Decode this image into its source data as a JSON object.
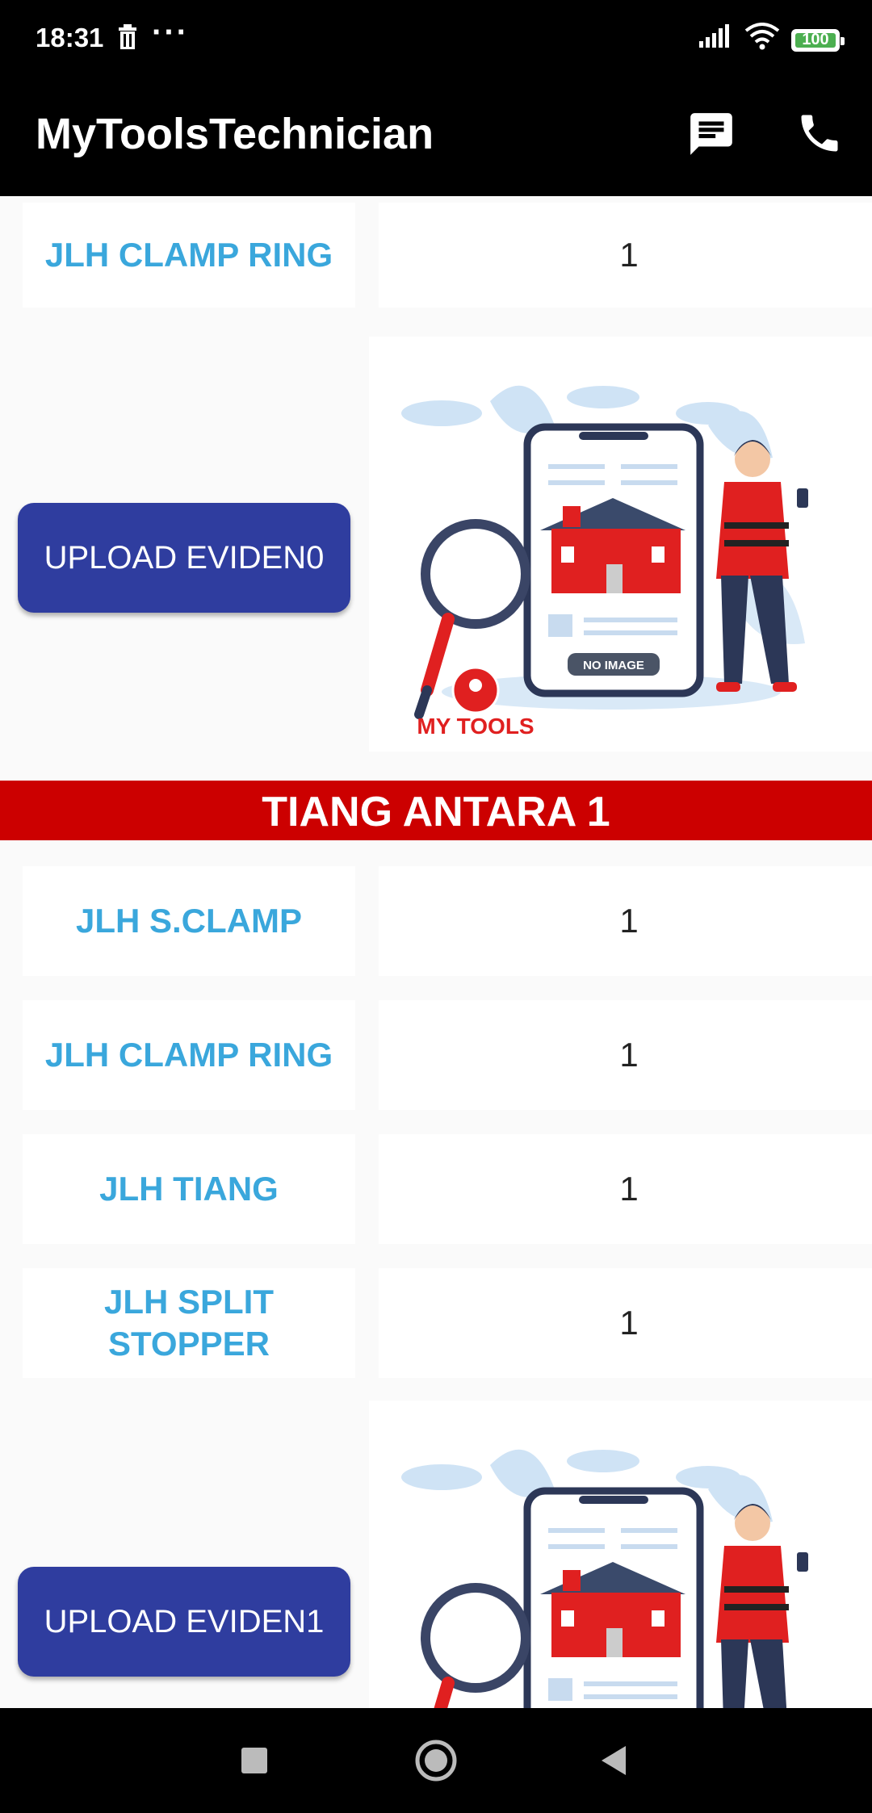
{
  "status_bar": {
    "time": "18:31",
    "more": "···",
    "battery": "100",
    "icons": [
      "trash-icon",
      "signal-icon",
      "wifi-icon",
      "battery-icon"
    ]
  },
  "app_bar": {
    "title": "MyToolsTechnician",
    "icons": [
      "message-icon",
      "phone-icon"
    ]
  },
  "top_rows": [
    {
      "label": "JLH CLAMP RING",
      "value": "1"
    }
  ],
  "upload0": {
    "label": "UPLOAD EVIDEN0"
  },
  "placeholder": {
    "no_image": "NO IMAGE",
    "brand": "MY TOOLS"
  },
  "section": {
    "title": "TIANG ANTARA 1",
    "rows": [
      {
        "label": "JLH S.CLAMP",
        "value": "1"
      },
      {
        "label": "JLH CLAMP RING",
        "value": "1"
      },
      {
        "label": "JLH TIANG",
        "value": "1"
      },
      {
        "label": "JLH SPLIT STOPPER",
        "value": "1"
      }
    ],
    "upload": {
      "label": "UPLOAD EVIDEN1"
    }
  },
  "colors": {
    "accent": "#3aa7dc",
    "button": "#2f3d9f",
    "header": "#cc0000"
  },
  "nav_bar": {
    "icons": [
      "recents-square-icon",
      "home-circle-icon",
      "back-triangle-icon"
    ]
  }
}
